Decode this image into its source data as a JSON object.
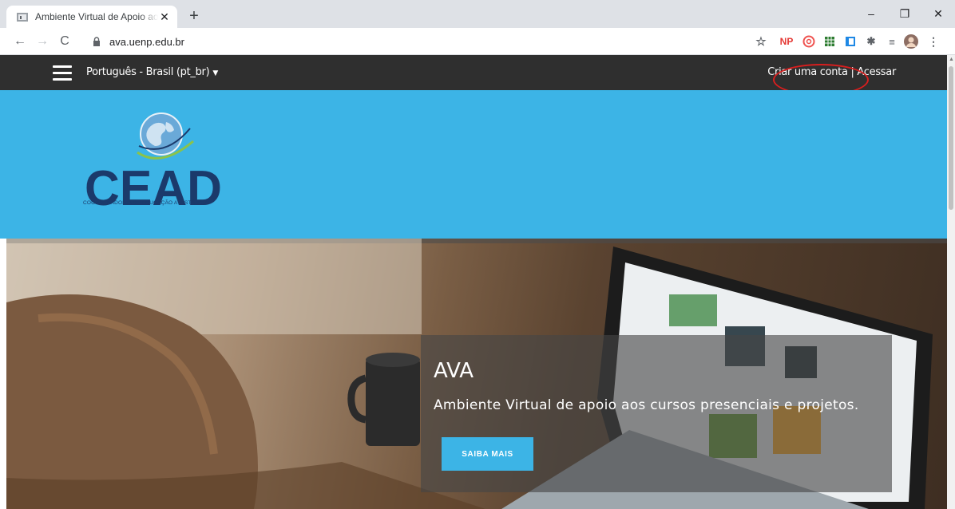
{
  "browser": {
    "tab_title": "Ambiente Virtual de Apoio aos C",
    "tab_close": "✕",
    "new_tab": "+",
    "url": "ava.uenp.edu.br",
    "window": {
      "minimize": "–",
      "restore": "❐",
      "close": "✕"
    },
    "extensions": [
      "NP"
    ]
  },
  "topnav": {
    "language": "Português - Brasil (pt_br)",
    "create_account": "Criar uma conta",
    "separator": "|",
    "login": "Acessar"
  },
  "banner": {
    "logo_text": "CEAD",
    "logo_tagline": "COORDENADORIA DE EDUCAÇÃO A DISTÂNCIA"
  },
  "hero": {
    "title": "AVA",
    "subtitle": "Ambiente Virtual de apoio aos cursos presenciais e projetos.",
    "button_label": "SAIBA MAIS"
  },
  "colors": {
    "topnav_bg": "#2f2f2f",
    "banner_bg": "#3cb4e6",
    "button_bg": "#3cb4e6",
    "annotation": "#d81e1e"
  }
}
